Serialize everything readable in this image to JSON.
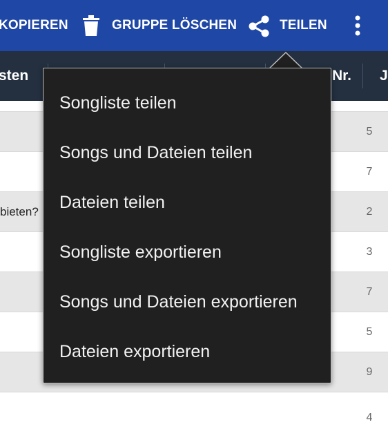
{
  "toolbar": {
    "copy_label": "KOPIEREN",
    "delete_group_label": "GRUPPE LÖSCHEN",
    "share_label": "TEILEN",
    "icons": [
      "trash-icon",
      "share-icon",
      "overflow-menu-icon"
    ],
    "color": "#1f47a6"
  },
  "table_header": {
    "col1": "sten",
    "col_nr": "Nr.",
    "col_last": "J",
    "color": "#243040"
  },
  "rows": [
    {
      "text": "",
      "num": "5"
    },
    {
      "text": "",
      "num": "7"
    },
    {
      "text": "bieten?",
      "num": "2"
    },
    {
      "text": "",
      "num": "3"
    },
    {
      "text": "",
      "num": "7"
    },
    {
      "text": "",
      "num": "5"
    },
    {
      "text": "",
      "num": "9"
    },
    {
      "text": "",
      "num": "4"
    }
  ],
  "menu": {
    "items": [
      "Songliste teilen",
      "Songs und Dateien teilen",
      "Dateien teilen",
      "Songliste exportieren",
      "Songs und Dateien exportieren",
      "Dateien exportieren"
    ],
    "background": "#202020"
  }
}
